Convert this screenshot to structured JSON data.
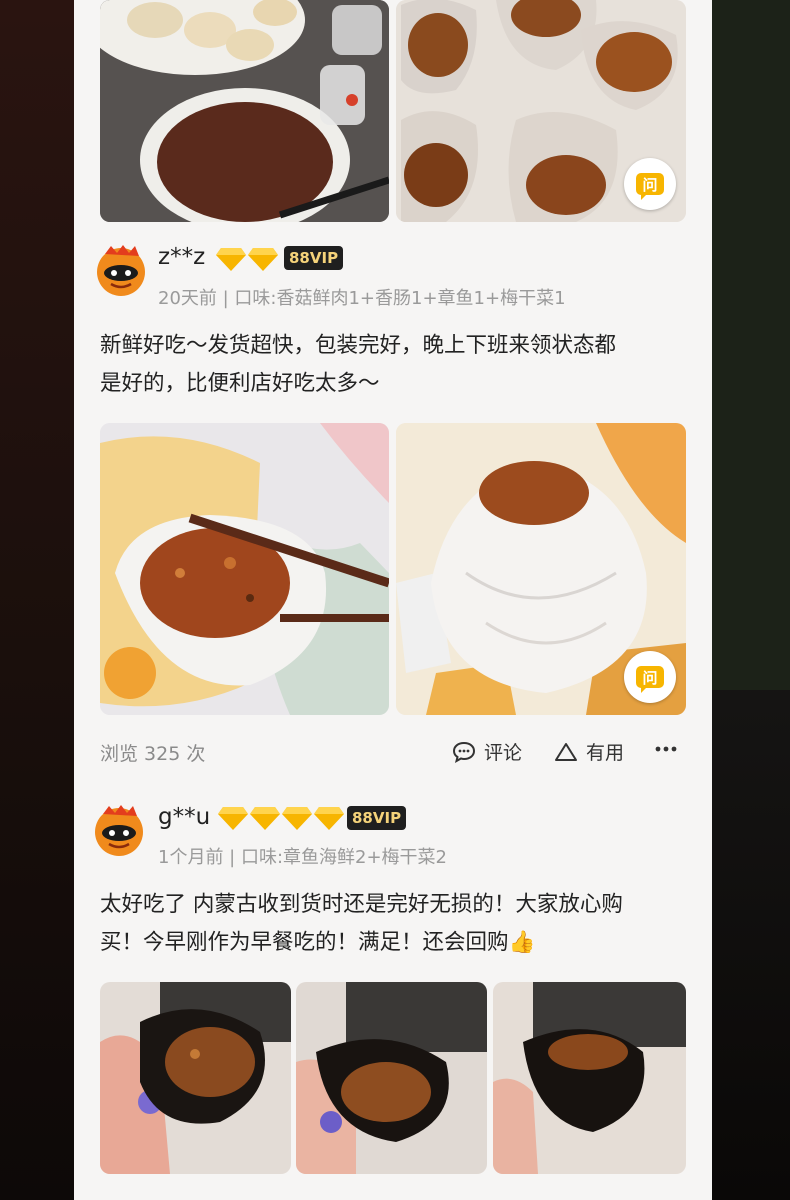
{
  "reviews": [
    {
      "username": "z**z",
      "diamonds": 2,
      "vip": "88VIP",
      "meta": "20天前 | 口味:香菇鲜肉1+香肠1+章鱼1+梅干菜1",
      "text_lines": [
        "新鲜好吃～发货超快，包装完好，晚上下班来领状态都",
        "是好的，比便利店好吃太多～"
      ],
      "views": "浏览 325 次",
      "comment_label": "评论",
      "useful_label": "有用",
      "ask_label": "问"
    },
    {
      "username": "g**u",
      "diamonds": 4,
      "vip": "88VIP",
      "meta": "1个月前 | 口味:章鱼海鲜2+梅干菜2",
      "text_lines": [
        "太好吃了 内蒙古收到货时还是完好无损的！大家放心购",
        "买！今早刚作为早餐吃的！满足！还会回购👍"
      ]
    }
  ],
  "colors": {
    "accent": "#f7b500",
    "vip_text": "#f5d37a",
    "card_bg": "#f6f5f4"
  },
  "icons": [
    "diamond-icon",
    "comment-icon",
    "useful-icon",
    "more-icon",
    "ask-icon"
  ]
}
